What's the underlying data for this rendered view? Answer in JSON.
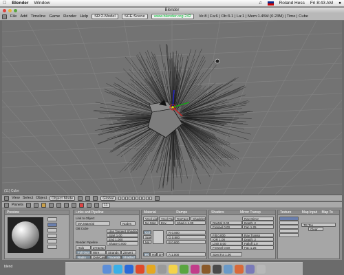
{
  "mac_menubar": {
    "app": "Blender",
    "menus": [
      "Window"
    ],
    "user": "Roland Hess",
    "clock": "Fri 8:43 AM"
  },
  "window": {
    "title": "Blender"
  },
  "blender_header": {
    "menus": [
      "File",
      "Add",
      "Timeline",
      "Game",
      "Render",
      "Help"
    ],
    "screen": "SR:2-Model",
    "scene": "SCE:Scene",
    "url": "www.blender.org 242",
    "stats": "Ve:8 | Fa:6 | Ob:3-1 | La:1 | Mem:1.45M (0.23M) | Time | Cube"
  },
  "viewport": {
    "label": "(11) Cube"
  },
  "view3d_header": {
    "menus": [
      "View",
      "Select",
      "Object"
    ],
    "mode": "Object Mode",
    "orientation": "Global"
  },
  "buttons_header": {
    "menu": "Panels",
    "frame": "11"
  },
  "panels": {
    "preview": {
      "title": "Preview"
    },
    "links": {
      "title": "Links and Pipeline",
      "link_to_object": "Link to Object",
      "ma_field": "MA:Material",
      "ob_field": "OB:Cube",
      "nodes": "Nodes",
      "render_pipeline": "Render Pipeline",
      "halo": "Halo",
      "ztransp": "ZTransp",
      "full_osa": "Full Osa",
      "wire": "Wire",
      "strands": "Strands",
      "zinvert": "ZInvert",
      "radio": "Radio",
      "only_cast": "OnlyCast",
      "traceable": "Traceable",
      "shadbuf": "Shadbuf",
      "tangent_shading": "Use Tangent Shading",
      "start": "Start 1.00",
      "end": "End 1.000",
      "shape": "Shape 0.000"
    },
    "material": {
      "title": "Material",
      "tab_ramps": "Ramps",
      "vcol_light": "VCol Light",
      "vcol_paint": "VCol Paint",
      "tex_face": "TexFace",
      "shadeless": "Shadeless",
      "no_mist": "No Mist",
      "env": "Env",
      "shad_a": "Shad A 1.00",
      "col": "Col",
      "spe": "Spe",
      "mir": "Mir",
      "r": "R 0.800",
      "g": "G 0.800",
      "b": "B 0.800",
      "a": "A 1.000",
      "rgb": "RGB",
      "hsv": "HSV",
      "dyn": "DYN"
    },
    "mirror": {
      "tab_shaders": "Shaders",
      "title": "Mirror Transp",
      "ray_mirror": "Ray Mirror",
      "ray_mir": "RayMir 0.00",
      "depth1": "Depth: 2",
      "fresnel": "Fresnel 0.00",
      "fac1": "Fac 1.25",
      "filt": "Filt 0.000",
      "ray_transp": "Ray Transp",
      "ior": "IOR 1.00",
      "depth2": "Depth: 2",
      "limit": "Limit 0.00",
      "falloff": "Falloff 1.0",
      "fresnel2": "Fresnel 0.00",
      "fac2": "Fac 1.25",
      "spec_tra": "SpecTra 1.00"
    },
    "texture": {
      "title": "Texture",
      "map_input": "Map Input",
      "map_to": "Map To",
      "tex_name": "TE:Tex",
      "clear": "Clear"
    }
  },
  "desktop": {
    "label": "blend"
  },
  "colors": {
    "viewport_bg": "#737373",
    "panel_bg": "#a6a6a6",
    "header_bg": "#b8b8b8",
    "url_green": "#00bb33",
    "active_button": "#6a7fae"
  }
}
